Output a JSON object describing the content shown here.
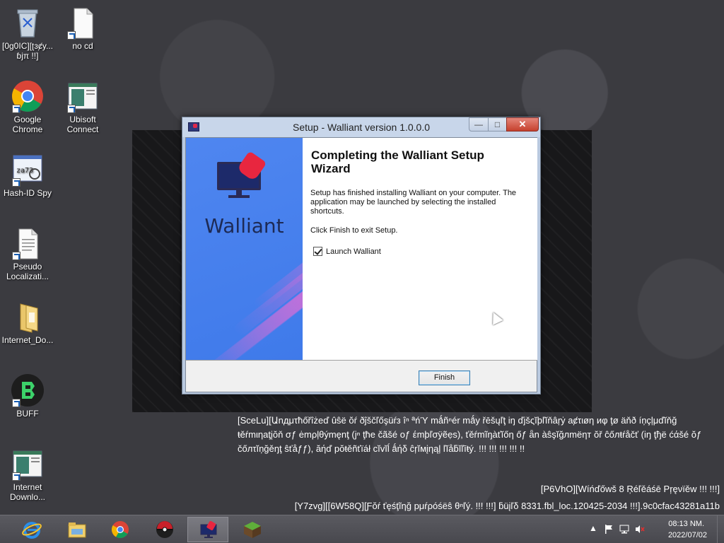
{
  "desktop": {
    "icons": [
      {
        "label": "[0g0IC][ʈɜȼy... ɓjπ !!]",
        "icon": "recycle-bin-icon"
      },
      {
        "label": "no cd",
        "icon": "file-icon"
      },
      {
        "label": "Google Chrome",
        "icon": "chrome-icon"
      },
      {
        "label": "Ubisoft Connect",
        "icon": "app-window-icon"
      },
      {
        "label": "Hash-ID Spy",
        "icon": "hash-id-icon"
      },
      {
        "label": "Pseudo Localizati...",
        "icon": "text-file-icon"
      },
      {
        "label": "Internet_Do...",
        "icon": "folder-icon"
      },
      {
        "label": "BUFF",
        "icon": "buff-icon"
      },
      {
        "label": "Internet Downlo...",
        "icon": "app-window-icon"
      }
    ]
  },
  "dialog": {
    "title": "Setup - Walliant version 1.0.0.0",
    "minimize_glyph": "—",
    "maximize_glyph": "□",
    "close_glyph": "✕",
    "brand": "Walliant",
    "heading": "Completing the Walliant Setup Wizard",
    "description": "Setup has finished installing Walliant on your computer. The application may be launched by selecting the installed shortcuts.",
    "instruction": "Click Finish to exit Setup.",
    "launch_label": "Launch Walliant",
    "launch_checked": true,
    "finish_label": "Finish"
  },
  "watermark": {
    "text": "[SceLu][Աnдμτħőřîżеď ûŝë ŏŕ ðĵščľőşüŕз îⁿ ªńΎ mǻñⁿér mǻy řēšųľţ iŋ ďjšςĭþľĭňâŗẏ aȼτιøη иφ ţø äňð íņçļμďĭňğ ŧěŕmιηаţįŏň σƒ ėmρļθýmęnţ (jⁿ ţħe čãšé oƒ έmþľσÿẽẹs), ťěŕmĩŋàťĭőη őƒ ǟn àŝşĭğлmëηт ŏř ĉőлŧŕåčť (iŋ ţђë ćάšé ŏƒ čőлτĭņğěŋţ ŝťåƒƒ), ăήď pŏŧěñťïáł cĭvĭĺ ǻήδ ĉŗĭмįηąļ ľĭåƃĭľīŧý. !!! !!! !!! !!! !!",
    "build_line1": "[P6VhO][Wíńďőwš 8 Ŗéľěáśē Ρŗęνïěw !!! !!!]",
    "build_line2": "[Y7zvg][[6W58Q][Ƒŏŕ ťęśţĩηğ рμŕρóśëŝ θⁿľý. !!! !!!] ƃüįľδ 8331.fbl_loc.120425-2034 !!!].9c0cfac43281a11b"
  },
  "taskbar": {
    "items": [
      {
        "name": "internet-explorer",
        "active": false
      },
      {
        "name": "file-explorer",
        "active": false
      },
      {
        "name": "google-chrome",
        "active": false
      },
      {
        "name": "pokemon-app",
        "active": false
      },
      {
        "name": "walliant-setup",
        "active": true
      },
      {
        "name": "minecraft-app",
        "active": false
      }
    ],
    "tray": {
      "chevron": "▲",
      "time": "08:13 NM.",
      "date": "2022/07/02"
    }
  },
  "colors": {
    "side_panel": "#4a82ee",
    "close_button": "#c6402d",
    "finish_border": "#3c7fb1"
  }
}
